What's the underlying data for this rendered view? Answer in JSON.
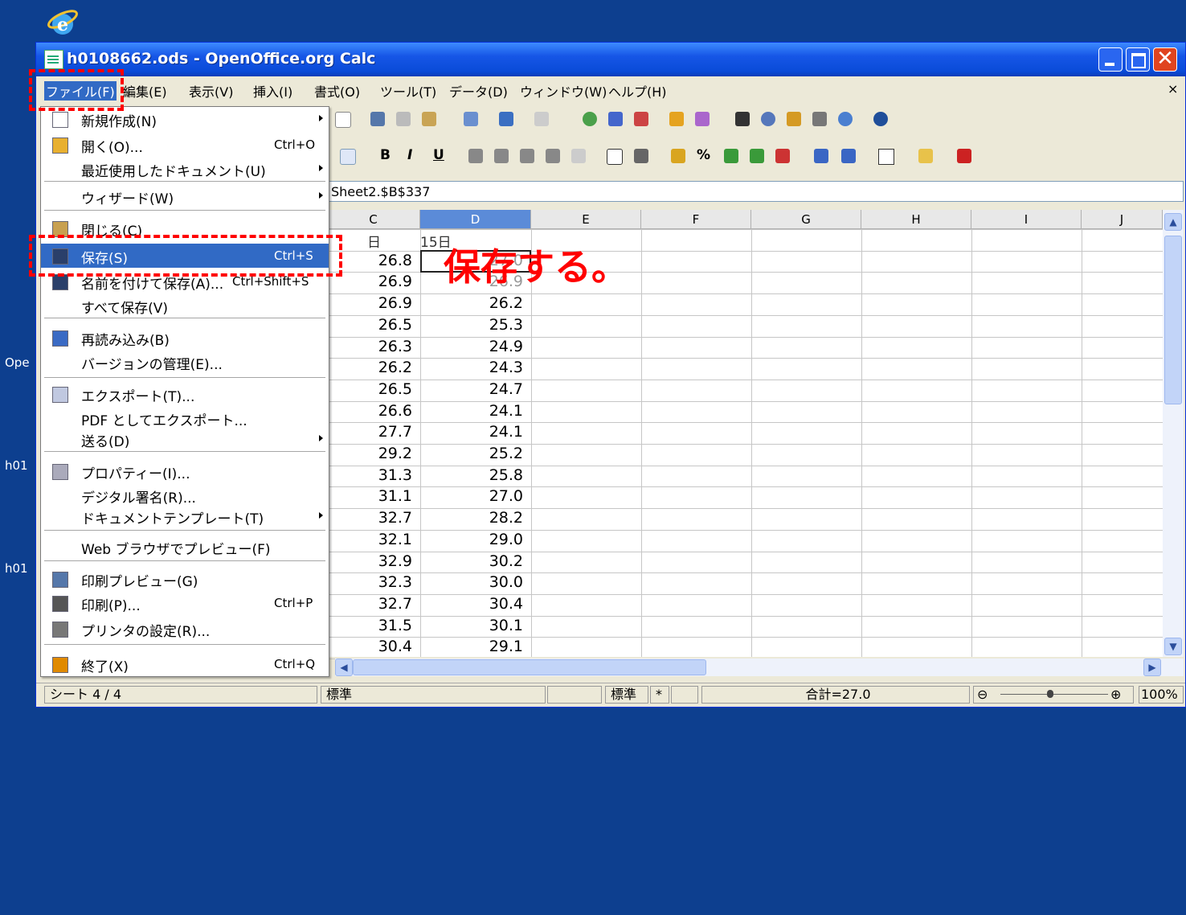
{
  "desktop": {
    "labels": [
      "Ope",
      "h01",
      "h01"
    ]
  },
  "window": {
    "title": "h0108662.ods - OpenOffice.org Calc",
    "close_glyph": "✕"
  },
  "menubar": {
    "items": [
      "ファイル(F)",
      "編集(E)",
      "表示(V)",
      "挿入(I)",
      "書式(O)",
      "ツール(T)",
      "データ(D)",
      "ウィンドウ(W)",
      "ヘルプ(H)"
    ],
    "close_doc": "×"
  },
  "toolbar": {
    "bold": "B",
    "italic": "I",
    "underline": "U",
    "percent": "%"
  },
  "formula": {
    "name_box": "Sheet2.$B$337"
  },
  "grid": {
    "columns": [
      "C",
      "D",
      "E",
      "F",
      "G",
      "H",
      "I",
      "J"
    ],
    "selected_col": "D",
    "header_c": "日",
    "header_d": "15日",
    "col_c": [
      "26.8",
      "26.9",
      "26.9",
      "26.5",
      "26.3",
      "26.2",
      "26.5",
      "26.6",
      "27.7",
      "29.2",
      "31.3",
      "31.1",
      "32.7",
      "32.1",
      "32.9",
      "32.3",
      "32.7",
      "31.5",
      "30.4"
    ],
    "col_d": [
      "27.0",
      "26.9",
      "26.2",
      "25.3",
      "24.9",
      "24.3",
      "24.7",
      "24.1",
      "24.1",
      "25.2",
      "25.8",
      "27.0",
      "28.2",
      "29.0",
      "30.2",
      "30.0",
      "30.4",
      "30.1",
      "29.1"
    ]
  },
  "statusbar": {
    "sheet": "シート 4 / 4",
    "style": "標準",
    "mode": "標準",
    "modified": "*",
    "sum": "合計=27.0",
    "zoom": "100%"
  },
  "file_menu": {
    "items": [
      {
        "label": "新規作成(N)",
        "shortcut": "",
        "submenu": true
      },
      {
        "label": "開く(O)...",
        "shortcut": "Ctrl+O",
        "submenu": false
      },
      {
        "label": "最近使用したドキュメント(U)",
        "shortcut": "",
        "submenu": true
      },
      {
        "label": "ウィザード(W)",
        "shortcut": "",
        "submenu": true
      },
      {
        "label": "閉じる(C)",
        "shortcut": "",
        "submenu": false
      },
      {
        "label": "保存(S)",
        "shortcut": "Ctrl+S",
        "submenu": false
      },
      {
        "label": "名前を付けて保存(A)...",
        "shortcut": "Ctrl+Shift+S",
        "submenu": false
      },
      {
        "label": "すべて保存(V)",
        "shortcut": "",
        "submenu": false
      },
      {
        "label": "再読み込み(B)",
        "shortcut": "",
        "submenu": false
      },
      {
        "label": "バージョンの管理(E)...",
        "shortcut": "",
        "submenu": false
      },
      {
        "label": "エクスポート(T)...",
        "shortcut": "",
        "submenu": false
      },
      {
        "label": "PDF としてエクスポート...",
        "shortcut": "",
        "submenu": false
      },
      {
        "label": "送る(D)",
        "shortcut": "",
        "submenu": true
      },
      {
        "label": "プロパティー(I)...",
        "shortcut": "",
        "submenu": false
      },
      {
        "label": "デジタル署名(R)...",
        "shortcut": "",
        "submenu": false
      },
      {
        "label": "ドキュメントテンプレート(T)",
        "shortcut": "",
        "submenu": true
      },
      {
        "label": "Web ブラウザでプレビュー(F)",
        "shortcut": "",
        "submenu": false
      },
      {
        "label": "印刷プレビュー(G)",
        "shortcut": "",
        "submenu": false
      },
      {
        "label": "印刷(P)...",
        "shortcut": "Ctrl+P",
        "submenu": false
      },
      {
        "label": "プリンタの設定(R)...",
        "shortcut": "",
        "submenu": false
      },
      {
        "label": "終了(X)",
        "shortcut": "Ctrl+Q",
        "submenu": false
      }
    ],
    "highlighted": "保存(S)"
  },
  "annotation": {
    "text": "保存する。",
    "color": "#ff0000"
  }
}
